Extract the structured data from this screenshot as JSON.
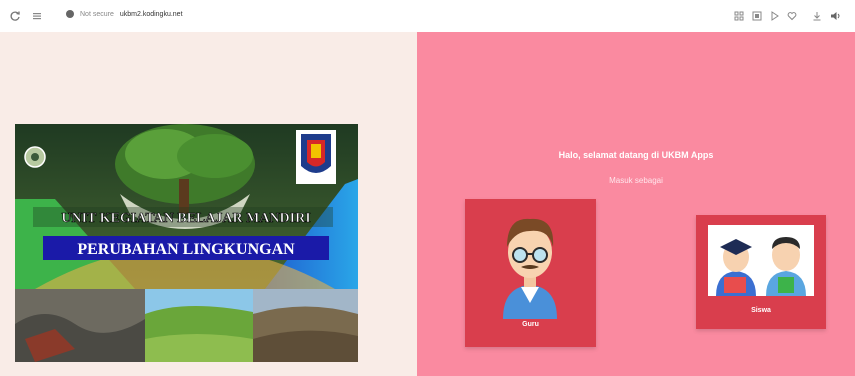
{
  "browser": {
    "back_icon": "reload-icon",
    "menu_icon": "menu-icon",
    "security_label": "Not secure",
    "url_host": "ukbm2.kodingku.net",
    "right_icons": [
      "grid-icon",
      "qr-icon",
      "cast-icon",
      "heart-icon",
      "download-icon",
      "speaker-icon"
    ]
  },
  "banner": {
    "line1": "UNIT KEGIATAN BELAJAR MANDIRI",
    "line2": "PERUBAHAN LINGKUNGAN"
  },
  "welcome": {
    "greeting": "Halo, selamat datang di UKBM Apps",
    "subtitle": "Masuk sebagai"
  },
  "roles": [
    {
      "label": "Guru"
    },
    {
      "label": "Siswa"
    }
  ],
  "colors": {
    "left_bg": "#f9ece7",
    "right_bg": "#fa8aa0",
    "card_bg": "#d93e4d"
  }
}
